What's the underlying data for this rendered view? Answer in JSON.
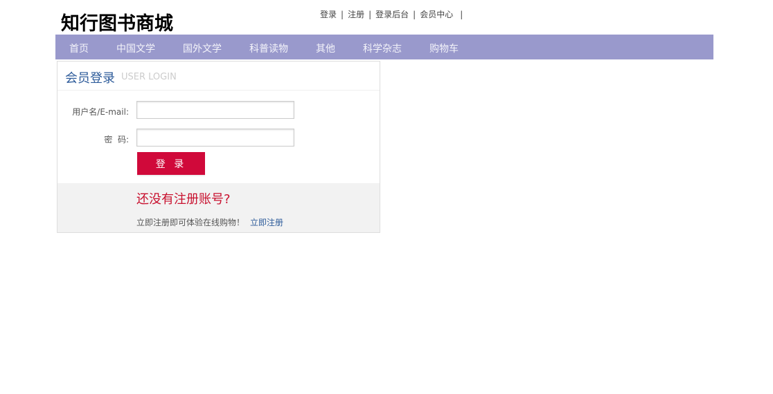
{
  "site": {
    "logo": "知行图书商城"
  },
  "toplinks": [
    "登录",
    "注册",
    "登录后台",
    "会员中心"
  ],
  "separator": "|",
  "nav": [
    "首页",
    "中国文学",
    "国外文学",
    "科普读物",
    "其他",
    "科学杂志",
    "购物车"
  ],
  "login": {
    "title": "会员登录",
    "subtitle": "USER LOGIN",
    "username_label": "用户名/E-mail:",
    "password_label": "密  码:",
    "username_value": "",
    "password_value": "",
    "submit": "登 录"
  },
  "register": {
    "question": "还没有注册账号?",
    "hint": "立即注册即可体验在线购物！",
    "link": "立即注册"
  },
  "colors": {
    "nav": "#9999cc",
    "button": "#d0093a",
    "title": "#2d5b9a"
  }
}
